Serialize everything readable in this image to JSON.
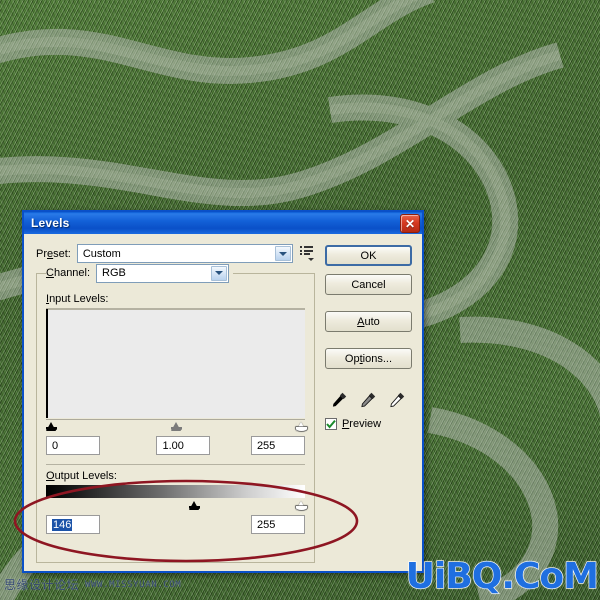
{
  "window": {
    "title": "Levels",
    "close_label": "✕"
  },
  "preset": {
    "label": "Preset:",
    "label_accel": "e",
    "value": "Custom",
    "menu_icon": "preset-options-icon"
  },
  "channel": {
    "label": "Channel:",
    "label_accel": "C",
    "value": "RGB"
  },
  "input_levels": {
    "label": "Input Levels:",
    "label_accel": "I",
    "black": "0",
    "gamma": "1.00",
    "white": "255",
    "black_pos_pct": 0,
    "gamma_pos_pct": 50,
    "white_pos_pct": 100
  },
  "output_levels": {
    "label": "Output Levels:",
    "label_accel": "O",
    "black": "146",
    "black_selected": true,
    "white": "255",
    "black_pos_pct": 57,
    "white_pos_pct": 100
  },
  "buttons": {
    "ok": "OK",
    "cancel": "Cancel",
    "auto": "Auto",
    "auto_accel": "A",
    "options": "Options...",
    "options_accel": "t"
  },
  "eyedroppers": [
    {
      "name": "set-black-point-eyedropper",
      "tip": "#000000"
    },
    {
      "name": "set-gray-point-eyedropper",
      "tip": "#808080"
    },
    {
      "name": "set-white-point-eyedropper",
      "tip": "#ffffff"
    }
  ],
  "preview": {
    "label": "Preview",
    "label_accel": "P",
    "checked": true
  },
  "annotation": {
    "type": "ellipse",
    "color": "#8e1622",
    "target": "output-levels-area"
  },
  "watermarks": {
    "bottom_left_cn": "思缘设计论坛",
    "bottom_left_url": "WWW.MISSYUAN.COM",
    "bottom_right": "UiBQ.CoM",
    "bottom_right_color": "#1f6fe0"
  },
  "colors": {
    "titlebar": "#0a50c8",
    "dialog_face": "#ece9d8",
    "background_green": "#3f6b2e",
    "selection_blue": "#1c53a8"
  }
}
